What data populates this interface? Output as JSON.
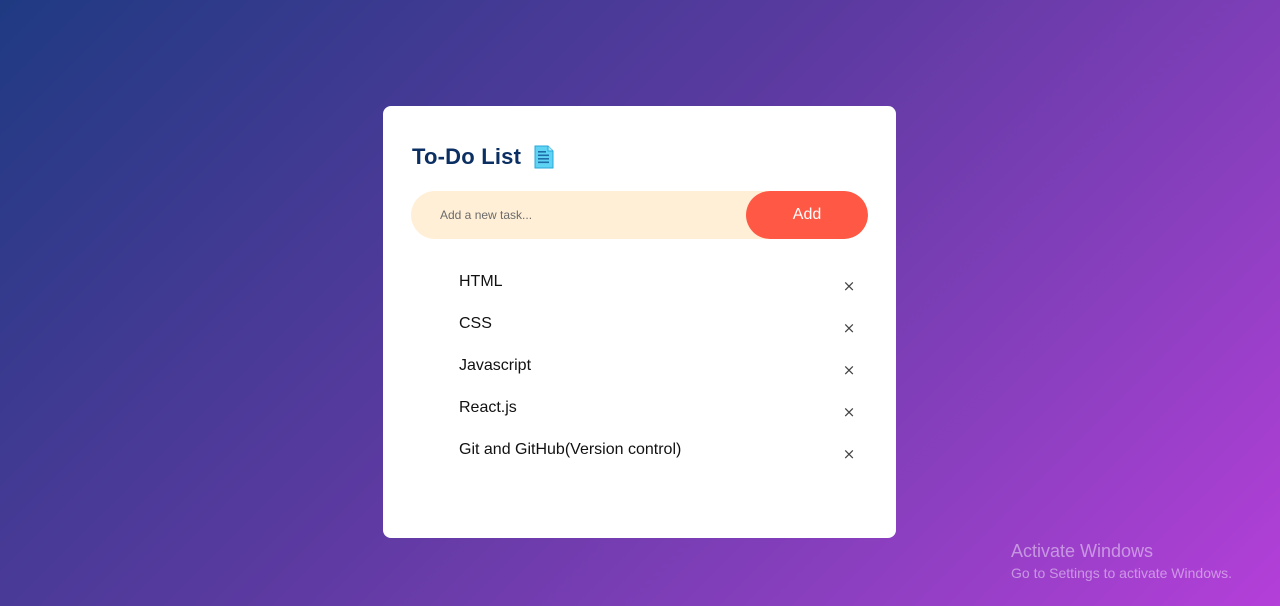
{
  "app": {
    "title": "To-Do List",
    "title_icon": "notepad-icon"
  },
  "input": {
    "placeholder": "Add a new task...",
    "value": "",
    "add_label": "Add"
  },
  "tasks": [
    {
      "text": "HTML",
      "remove_label": "×"
    },
    {
      "text": "CSS",
      "remove_label": "×"
    },
    {
      "text": "Javascript",
      "remove_label": "×"
    },
    {
      "text": "React.js",
      "remove_label": "×"
    },
    {
      "text": "Git and GitHub(Version control)",
      "remove_label": "×"
    }
  ],
  "watermark": {
    "title": "Activate Windows",
    "subtitle": "Go to Settings to activate Windows."
  },
  "colors": {
    "title": "#0b2f63",
    "add_button": "#ff5945",
    "input_bg": "#ffefd6",
    "card": "#ffffff"
  }
}
